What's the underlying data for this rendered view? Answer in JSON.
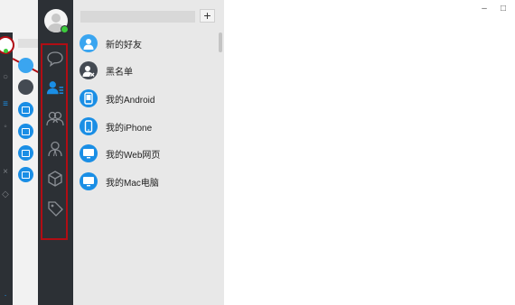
{
  "colors": {
    "sidebar": "#2c3035",
    "panel": "#e8e8e8",
    "accent_blue": "#1a8ee5",
    "light_blue": "#3aa5f0",
    "dark_icon": "#444a52",
    "highlight_red": "#b10d14",
    "online_green": "#3ccb3c"
  },
  "window_controls": {
    "minimize": "–",
    "maximize": "□"
  },
  "search": {
    "placeholder": ""
  },
  "toolbar": {
    "add_label": "+"
  },
  "nav": [
    {
      "icon": "chat-bubble-icon",
      "active": false
    },
    {
      "icon": "contacts-icon",
      "active": true
    },
    {
      "icon": "group-icon",
      "active": false
    },
    {
      "icon": "person-icon",
      "active": false
    },
    {
      "icon": "cube-icon",
      "active": false
    },
    {
      "icon": "tag-icon",
      "active": false
    }
  ],
  "contacts": [
    {
      "label": "新的好友",
      "icon": "new-friend-icon"
    },
    {
      "label": "黑名单",
      "icon": "blacklist-icon"
    },
    {
      "label": "我的Android",
      "icon": "android-device-icon"
    },
    {
      "label": "我的iPhone",
      "icon": "iphone-device-icon"
    },
    {
      "label": "我的Web网页",
      "icon": "web-device-icon"
    },
    {
      "label": "我的Mac电脑",
      "icon": "mac-device-icon"
    }
  ]
}
